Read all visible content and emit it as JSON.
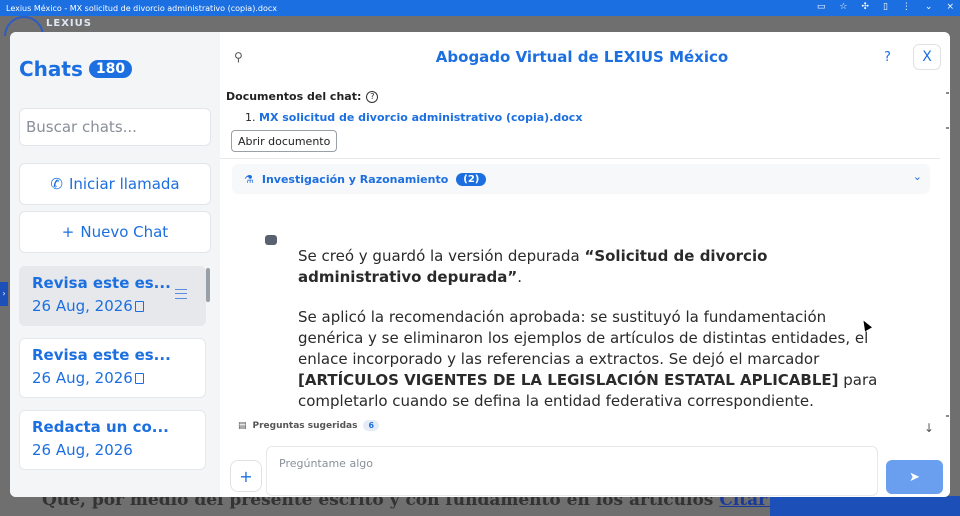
{
  "window": {
    "title": "Lexius México - MX solicitud de divorcio administrativo (copia).docx"
  },
  "background": {
    "text_prefix": "Que, por medio del presente escrito y con fundamento en los artículos",
    "text_link": "Citar artículos espe"
  },
  "sidebar": {
    "title": "Chats",
    "count": "180",
    "search_placeholder": "Buscar chats...",
    "call_button": "Iniciar llamada",
    "new_chat_button": "Nuevo Chat",
    "chats": [
      {
        "title": "Revisa este es...",
        "date": "26 Aug, 2026"
      },
      {
        "title": "Revisa este es...",
        "date": "26 Aug, 2026"
      },
      {
        "title": "Redacta un co...",
        "date": "26 Aug, 2026"
      }
    ]
  },
  "main": {
    "title": "Abogado Virtual de LEXIUS México",
    "help_label": "?",
    "close_label": "X",
    "documents_label": "Documentos del chat:",
    "document_index": "1.",
    "document_name": "MX solicitud de divorcio administrativo (copia).docx",
    "open_document": "Abrir documento",
    "research_label": "Investigación y Razonamiento",
    "research_count": "(2)",
    "message": {
      "p1_a": "Se creó y guardó la versión depurada ",
      "p1_b": "“Solicitud de divorcio administrativo depurada”",
      "p1_c": ".",
      "p2_a": "Se aplicó la recomendación aprobada: se sustituyó la fundamentación genérica y se eliminaron los ejemplos de artículos de distintas entidades, el enlace incorporado y las referencias a extractos. Se dejó el marcador ",
      "p2_b": "[ARTÍCULOS VIGENTES DE LA LEGISLACIÓN ESTATAL APLICABLE]",
      "p2_c": " para completarlo cuando se defina la entidad federativa correspondiente."
    },
    "suggested_label": "Preguntas sugeridas",
    "suggested_count": "6",
    "input_placeholder": "Pregúntame algo"
  }
}
